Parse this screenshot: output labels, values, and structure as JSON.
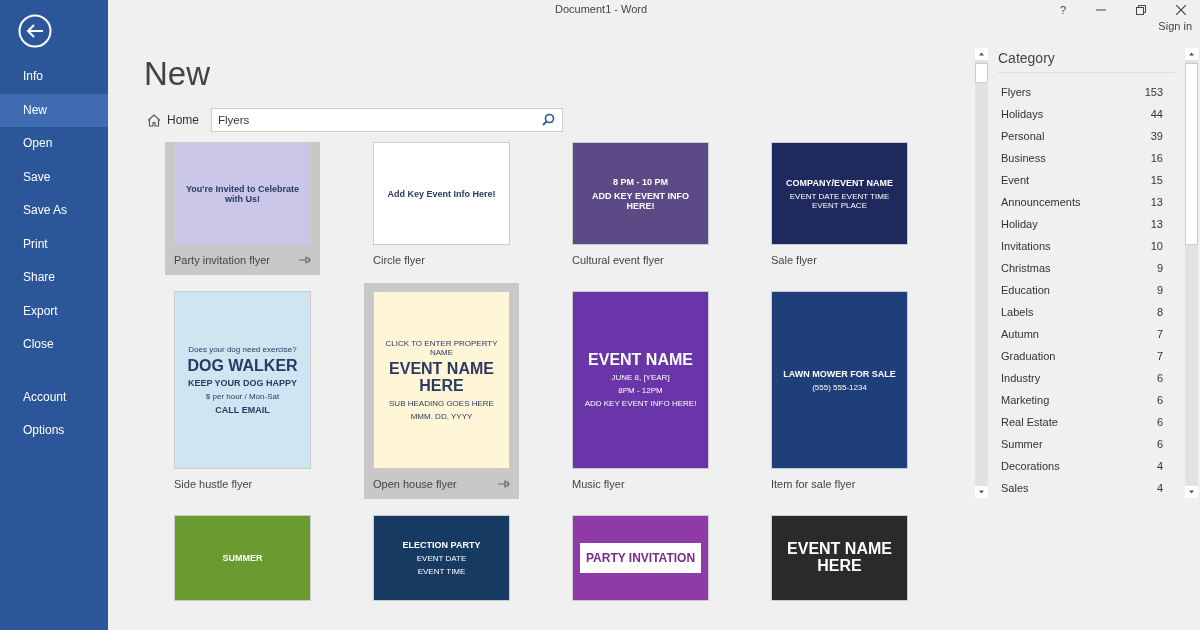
{
  "window": {
    "title": "Document1 - Word",
    "sign_in": "Sign in",
    "help": "?"
  },
  "sidebar": {
    "items": [
      {
        "label": "Info",
        "selected": false
      },
      {
        "label": "New",
        "selected": true
      },
      {
        "label": "Open",
        "selected": false
      },
      {
        "label": "Save",
        "selected": false
      },
      {
        "label": "Save As",
        "selected": false
      },
      {
        "label": "Print",
        "selected": false
      },
      {
        "label": "Share",
        "selected": false
      },
      {
        "label": "Export",
        "selected": false
      },
      {
        "label": "Close",
        "selected": false
      }
    ],
    "bottom_items": [
      {
        "label": "Account",
        "selected": false
      },
      {
        "label": "Options",
        "selected": false
      }
    ]
  },
  "page": {
    "title": "New",
    "home": "Home",
    "search": {
      "value": "Flyers"
    }
  },
  "templates": [
    {
      "name": "Party invitation flyer",
      "highlighted": true,
      "color": "#c9c6e8",
      "lines": [
        {
          "text": "You're Invited to Celebrate with Us!",
          "kind": "body"
        }
      ]
    },
    {
      "name": "Circle flyer",
      "highlighted": false,
      "color": "#ffffff",
      "lines": [
        {
          "text": "Add Key Event Info Here!",
          "kind": "body"
        }
      ]
    },
    {
      "name": "Cultural event flyer",
      "highlighted": false,
      "color": "#5b4a86",
      "lines": [
        {
          "text": "8 PM - 10 PM",
          "kind": "body"
        },
        {
          "text": "ADD KEY EVENT INFO HERE!",
          "kind": "body"
        }
      ]
    },
    {
      "name": "Sale flyer",
      "highlighted": false,
      "color": "#1e2a5e",
      "lines": [
        {
          "text": "COMPANY/EVENT NAME",
          "kind": "body"
        },
        {
          "text": "EVENT DATE   EVENT TIME   EVENT PLACE",
          "kind": "small"
        }
      ]
    },
    {
      "name": "Side hustle flyer",
      "highlighted": false,
      "color": "#cfe6f2",
      "lines": [
        {
          "text": "Does your dog need exercise?",
          "kind": "small"
        },
        {
          "text": "DOG WALKER",
          "kind": "heading"
        },
        {
          "text": "KEEP YOUR DOG HAPPY",
          "kind": "body"
        },
        {
          "text": "$ per hour / Mon-Sat",
          "kind": "small"
        },
        {
          "text": "CALL   EMAIL",
          "kind": "body"
        }
      ]
    },
    {
      "name": "Open house flyer",
      "highlighted": true,
      "color": "#fff6d8",
      "lines": [
        {
          "text": "CLICK TO ENTER PROPERTY NAME",
          "kind": "small"
        },
        {
          "text": "EVENT NAME HERE",
          "kind": "heading"
        },
        {
          "text": "SUB HEADING GOES HERE",
          "kind": "small"
        },
        {
          "text": "MMM. DD, YYYY",
          "kind": "small"
        }
      ]
    },
    {
      "name": "Music flyer",
      "highlighted": false,
      "color": "#6a35a8",
      "lines": [
        {
          "text": "EVENT NAME",
          "kind": "heading"
        },
        {
          "text": "JUNE 8, [YEAR]",
          "kind": "small"
        },
        {
          "text": "8PM - 12PM",
          "kind": "small"
        },
        {
          "text": "ADD KEY EVENT INFO HERE!",
          "kind": "small"
        }
      ]
    },
    {
      "name": "Item for sale flyer",
      "highlighted": false,
      "color": "#1e3f7a",
      "lines": [
        {
          "text": "LAWN MOWER FOR SALE",
          "kind": "body"
        },
        {
          "text": "(555) 555-1234",
          "kind": "small"
        }
      ]
    },
    {
      "highlighted": false,
      "color": "#6a9a30",
      "lines": [
        {
          "text": "SUMMER",
          "kind": "body"
        }
      ]
    },
    {
      "highlighted": false,
      "color": "#173a63",
      "lines": [
        {
          "text": "ELECTION PARTY",
          "kind": "body"
        },
        {
          "text": "EVENT DATE",
          "kind": "small"
        },
        {
          "text": "EVENT TIME",
          "kind": "small"
        }
      ]
    },
    {
      "highlighted": false,
      "color": "#8e3ba8",
      "lines": [
        {
          "text": "PARTY INVITATION",
          "kind": "panel"
        }
      ]
    },
    {
      "highlighted": false,
      "color": "#2a2a2a",
      "lines": [
        {
          "text": "EVENT NAME HERE",
          "kind": "heading"
        }
      ]
    }
  ],
  "category": {
    "title": "Category",
    "items": [
      {
        "label": "Flyers",
        "count": "153"
      },
      {
        "label": "Holidays",
        "count": "44"
      },
      {
        "label": "Personal",
        "count": "39"
      },
      {
        "label": "Business",
        "count": "16"
      },
      {
        "label": "Event",
        "count": "15"
      },
      {
        "label": "Announcements",
        "count": "13"
      },
      {
        "label": "Holiday",
        "count": "13"
      },
      {
        "label": "Invitations",
        "count": "10"
      },
      {
        "label": "Christmas",
        "count": "9"
      },
      {
        "label": "Education",
        "count": "9"
      },
      {
        "label": "Labels",
        "count": "8"
      },
      {
        "label": "Autumn",
        "count": "7"
      },
      {
        "label": "Graduation",
        "count": "7"
      },
      {
        "label": "Industry",
        "count": "6"
      },
      {
        "label": "Marketing",
        "count": "6"
      },
      {
        "label": "Real Estate",
        "count": "6"
      },
      {
        "label": "Summer",
        "count": "6"
      },
      {
        "label": "Decorations",
        "count": "4"
      },
      {
        "label": "Sales",
        "count": "4"
      }
    ]
  }
}
